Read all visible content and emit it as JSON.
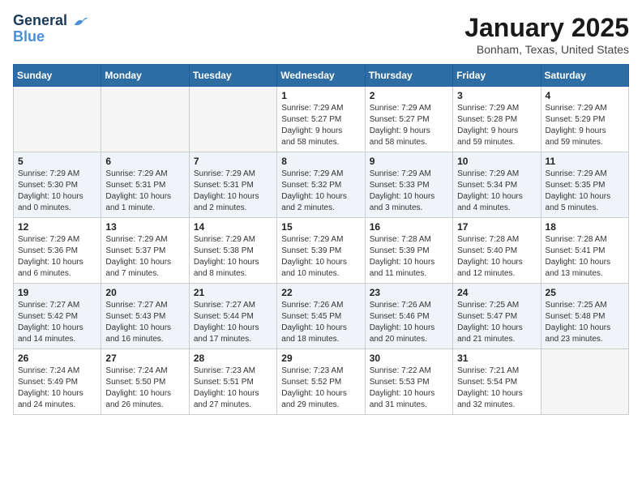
{
  "logo": {
    "line1": "General",
    "line2": "Blue"
  },
  "title": "January 2025",
  "location": "Bonham, Texas, United States",
  "headers": [
    "Sunday",
    "Monday",
    "Tuesday",
    "Wednesday",
    "Thursday",
    "Friday",
    "Saturday"
  ],
  "weeks": [
    [
      {
        "day": "",
        "info": ""
      },
      {
        "day": "",
        "info": ""
      },
      {
        "day": "",
        "info": ""
      },
      {
        "day": "1",
        "info": "Sunrise: 7:29 AM\nSunset: 5:27 PM\nDaylight: 9 hours\nand 58 minutes."
      },
      {
        "day": "2",
        "info": "Sunrise: 7:29 AM\nSunset: 5:27 PM\nDaylight: 9 hours\nand 58 minutes."
      },
      {
        "day": "3",
        "info": "Sunrise: 7:29 AM\nSunset: 5:28 PM\nDaylight: 9 hours\nand 59 minutes."
      },
      {
        "day": "4",
        "info": "Sunrise: 7:29 AM\nSunset: 5:29 PM\nDaylight: 9 hours\nand 59 minutes."
      }
    ],
    [
      {
        "day": "5",
        "info": "Sunrise: 7:29 AM\nSunset: 5:30 PM\nDaylight: 10 hours\nand 0 minutes."
      },
      {
        "day": "6",
        "info": "Sunrise: 7:29 AM\nSunset: 5:31 PM\nDaylight: 10 hours\nand 1 minute."
      },
      {
        "day": "7",
        "info": "Sunrise: 7:29 AM\nSunset: 5:31 PM\nDaylight: 10 hours\nand 2 minutes."
      },
      {
        "day": "8",
        "info": "Sunrise: 7:29 AM\nSunset: 5:32 PM\nDaylight: 10 hours\nand 2 minutes."
      },
      {
        "day": "9",
        "info": "Sunrise: 7:29 AM\nSunset: 5:33 PM\nDaylight: 10 hours\nand 3 minutes."
      },
      {
        "day": "10",
        "info": "Sunrise: 7:29 AM\nSunset: 5:34 PM\nDaylight: 10 hours\nand 4 minutes."
      },
      {
        "day": "11",
        "info": "Sunrise: 7:29 AM\nSunset: 5:35 PM\nDaylight: 10 hours\nand 5 minutes."
      }
    ],
    [
      {
        "day": "12",
        "info": "Sunrise: 7:29 AM\nSunset: 5:36 PM\nDaylight: 10 hours\nand 6 minutes."
      },
      {
        "day": "13",
        "info": "Sunrise: 7:29 AM\nSunset: 5:37 PM\nDaylight: 10 hours\nand 7 minutes."
      },
      {
        "day": "14",
        "info": "Sunrise: 7:29 AM\nSunset: 5:38 PM\nDaylight: 10 hours\nand 8 minutes."
      },
      {
        "day": "15",
        "info": "Sunrise: 7:29 AM\nSunset: 5:39 PM\nDaylight: 10 hours\nand 10 minutes."
      },
      {
        "day": "16",
        "info": "Sunrise: 7:28 AM\nSunset: 5:39 PM\nDaylight: 10 hours\nand 11 minutes."
      },
      {
        "day": "17",
        "info": "Sunrise: 7:28 AM\nSunset: 5:40 PM\nDaylight: 10 hours\nand 12 minutes."
      },
      {
        "day": "18",
        "info": "Sunrise: 7:28 AM\nSunset: 5:41 PM\nDaylight: 10 hours\nand 13 minutes."
      }
    ],
    [
      {
        "day": "19",
        "info": "Sunrise: 7:27 AM\nSunset: 5:42 PM\nDaylight: 10 hours\nand 14 minutes."
      },
      {
        "day": "20",
        "info": "Sunrise: 7:27 AM\nSunset: 5:43 PM\nDaylight: 10 hours\nand 16 minutes."
      },
      {
        "day": "21",
        "info": "Sunrise: 7:27 AM\nSunset: 5:44 PM\nDaylight: 10 hours\nand 17 minutes."
      },
      {
        "day": "22",
        "info": "Sunrise: 7:26 AM\nSunset: 5:45 PM\nDaylight: 10 hours\nand 18 minutes."
      },
      {
        "day": "23",
        "info": "Sunrise: 7:26 AM\nSunset: 5:46 PM\nDaylight: 10 hours\nand 20 minutes."
      },
      {
        "day": "24",
        "info": "Sunrise: 7:25 AM\nSunset: 5:47 PM\nDaylight: 10 hours\nand 21 minutes."
      },
      {
        "day": "25",
        "info": "Sunrise: 7:25 AM\nSunset: 5:48 PM\nDaylight: 10 hours\nand 23 minutes."
      }
    ],
    [
      {
        "day": "26",
        "info": "Sunrise: 7:24 AM\nSunset: 5:49 PM\nDaylight: 10 hours\nand 24 minutes."
      },
      {
        "day": "27",
        "info": "Sunrise: 7:24 AM\nSunset: 5:50 PM\nDaylight: 10 hours\nand 26 minutes."
      },
      {
        "day": "28",
        "info": "Sunrise: 7:23 AM\nSunset: 5:51 PM\nDaylight: 10 hours\nand 27 minutes."
      },
      {
        "day": "29",
        "info": "Sunrise: 7:23 AM\nSunset: 5:52 PM\nDaylight: 10 hours\nand 29 minutes."
      },
      {
        "day": "30",
        "info": "Sunrise: 7:22 AM\nSunset: 5:53 PM\nDaylight: 10 hours\nand 31 minutes."
      },
      {
        "day": "31",
        "info": "Sunrise: 7:21 AM\nSunset: 5:54 PM\nDaylight: 10 hours\nand 32 minutes."
      },
      {
        "day": "",
        "info": ""
      }
    ]
  ]
}
